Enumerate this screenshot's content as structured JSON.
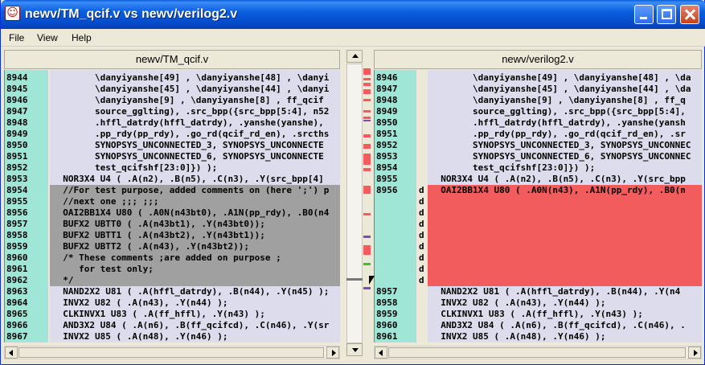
{
  "window": {
    "title": "newv/TM_qcif.v vs newv/verilog2.v"
  },
  "menu": [
    "File",
    "View",
    "Help"
  ],
  "left_pane": {
    "header": "newv/TM_qcif.v",
    "rows": [
      {
        "ln": "8944",
        "code": "        \\danyiyanshe[49] , \\danyiyanshe[48] , \\danyi",
        "state": "same"
      },
      {
        "ln": "8945",
        "code": "        \\danyiyanshe[45] , \\danyiyanshe[44] , \\danyi",
        "state": "same"
      },
      {
        "ln": "8946",
        "code": "        \\danyiyanshe[9] , \\danyiyanshe[8] , ff_qcif",
        "state": "same"
      },
      {
        "ln": "8947",
        "code": "        source_gglting), .src_bpp({src_bpp[5:4], n52",
        "state": "same"
      },
      {
        "ln": "8948",
        "code": "        .hffl_datrdy(hffl_datrdy), .yanshe(yanshe),",
        "state": "same"
      },
      {
        "ln": "8949",
        "code": "        .pp_rdy(pp_rdy), .go_rd(qcif_rd_en), .srcths",
        "state": "same"
      },
      {
        "ln": "8950",
        "code": "        SYNOPSYS_UNCONNECTED_3, SYNOPSYS_UNCONNECTE",
        "state": "same"
      },
      {
        "ln": "8951",
        "code": "        SYNOPSYS_UNCONNECTED_6, SYNOPSYS_UNCONNECTE",
        "state": "same"
      },
      {
        "ln": "8952",
        "code": "        test_qcifshf[23:0]}) );",
        "state": "same"
      },
      {
        "ln": "8953",
        "code": "  NOR3X4 U4 ( .A(n2), .B(n5), .C(n3), .Y(src_bpp[4]",
        "state": "same"
      },
      {
        "ln": "8954",
        "code": "  //For test purpose, added comments on (here ';') p",
        "state": "changed"
      },
      {
        "ln": "8955",
        "code": "  //next one ;;; ;;;",
        "state": "changed"
      },
      {
        "ln": "8956",
        "code": "  OAI2BB1X4 U80 ( .A0N(n43bt0), .A1N(pp_rdy), .B0(n4",
        "state": "changed"
      },
      {
        "ln": "8957",
        "code": "  BUFX2 UBTT0 ( .A(n43bt1), .Y(n43bt0));",
        "state": "changed"
      },
      {
        "ln": "8958",
        "code": "  BUFX2 UBTT1 ( .A(n43bt2), .Y(n43bt1));",
        "state": "changed"
      },
      {
        "ln": "8959",
        "code": "  BUFX2 UBTT2 ( .A(n43), .Y(n43bt2));",
        "state": "changed"
      },
      {
        "ln": "8960",
        "code": "  /* These comments ;are added on purpose ;",
        "state": "changed"
      },
      {
        "ln": "8961",
        "code": "     for test only;",
        "state": "changed"
      },
      {
        "ln": "8962",
        "code": "  */",
        "state": "changed"
      },
      {
        "ln": "8963",
        "code": "  NAND2X2 U81 ( .A(hffl_datrdy), .B(n44), .Y(n45) );",
        "state": "same"
      },
      {
        "ln": "8964",
        "code": "  INVX2 U82 ( .A(n43), .Y(n44) );",
        "state": "same"
      },
      {
        "ln": "8965",
        "code": "  CLKINVX1 U83 ( .A(ff_hffl), .Y(n43) );",
        "state": "same"
      },
      {
        "ln": "8966",
        "code": "  AND3X2 U84 ( .A(n6), .B(ff_qcifcd), .C(n46), .Y(sr",
        "state": "same"
      },
      {
        "ln": "8967",
        "code": "  INVX2 U85 ( .A(n48), .Y(n46) );",
        "state": "same"
      }
    ]
  },
  "right_pane": {
    "header": "newv/verilog2.v",
    "rows": [
      {
        "ln": "8946",
        "mk": "",
        "code": "        \\danyiyanshe[49] , \\danyiyanshe[48] , \\da",
        "state": "same"
      },
      {
        "ln": "8947",
        "mk": "",
        "code": "        \\danyiyanshe[45] , \\danyiyanshe[44] , \\da",
        "state": "same"
      },
      {
        "ln": "8948",
        "mk": "",
        "code": "        \\danyiyanshe[9] , \\danyiyanshe[8] , ff_q",
        "state": "same"
      },
      {
        "ln": "8949",
        "mk": "",
        "code": "        source_gglting), .src_bpp({src_bpp[5:4],",
        "state": "same"
      },
      {
        "ln": "8950",
        "mk": "",
        "code": "        .hffl_datrdy(hffl_datrdy), .yanshe(yansh",
        "state": "same"
      },
      {
        "ln": "8951",
        "mk": "",
        "code": "        .pp_rdy(pp_rdy), .go_rd(qcif_rd_en), .sr",
        "state": "same"
      },
      {
        "ln": "8952",
        "mk": "",
        "code": "        SYNOPSYS_UNCONNECTED_3, SYNOPSYS_UNCONNEC",
        "state": "same"
      },
      {
        "ln": "8953",
        "mk": "",
        "code": "        SYNOPSYS_UNCONNECTED_6, SYNOPSYS_UNCONNEC",
        "state": "same"
      },
      {
        "ln": "8954",
        "mk": "",
        "code": "        test_qcifshf[23:0]}) );",
        "state": "same"
      },
      {
        "ln": "8955",
        "mk": "",
        "code": "  NOR3X4 U4 ( .A(n2), .B(n5), .C(n3), .Y(src_bpp",
        "state": "same"
      },
      {
        "ln": "8956",
        "mk": "d",
        "code": "  OAI2BB1X4 U80 ( .A0N(n43), .A1N(pp_rdy), .B0(n",
        "state": "deleted"
      },
      {
        "ln": "",
        "mk": "d",
        "code": "",
        "state": "deleted"
      },
      {
        "ln": "",
        "mk": "d",
        "code": "",
        "state": "deleted"
      },
      {
        "ln": "",
        "mk": "d",
        "code": "",
        "state": "deleted"
      },
      {
        "ln": "",
        "mk": "d",
        "code": "",
        "state": "deleted"
      },
      {
        "ln": "",
        "mk": "d",
        "code": "",
        "state": "deleted"
      },
      {
        "ln": "",
        "mk": "d",
        "code": "",
        "state": "deleted"
      },
      {
        "ln": "",
        "mk": "d",
        "code": "",
        "state": "deleted"
      },
      {
        "ln": "",
        "mk": "d",
        "code": "",
        "state": "deleted"
      },
      {
        "ln": "8957",
        "mk": "",
        "code": "  NAND2X2 U81 ( .A(hffl_datrdy), .B(n44), .Y(n4",
        "state": "same"
      },
      {
        "ln": "8958",
        "mk": "",
        "code": "  INVX2 U82 ( .A(n43), .Y(n44) );",
        "state": "same"
      },
      {
        "ln": "8959",
        "mk": "",
        "code": "  CLKINVX1 U83 ( .A(ff_hffl), .Y(n43) );",
        "state": "same"
      },
      {
        "ln": "8960",
        "mk": "",
        "code": "  AND3X2 U84 ( .A(n6), .B(ff_qcifcd), .C(n46), .",
        "state": "same"
      },
      {
        "ln": "8961",
        "mk": "",
        "code": "  INVX2 U85 ( .A(n48), .Y(n46) );",
        "state": "same"
      }
    ]
  },
  "icons": {
    "app": "app-icon",
    "minimize": "minimize-icon",
    "maximize": "maximize-icon",
    "close": "close-icon"
  },
  "colors": {
    "gutter": "#9fe6d6",
    "changed": "#a0a0a0",
    "deleted": "#f25c5c",
    "same": "#dcdcec"
  }
}
